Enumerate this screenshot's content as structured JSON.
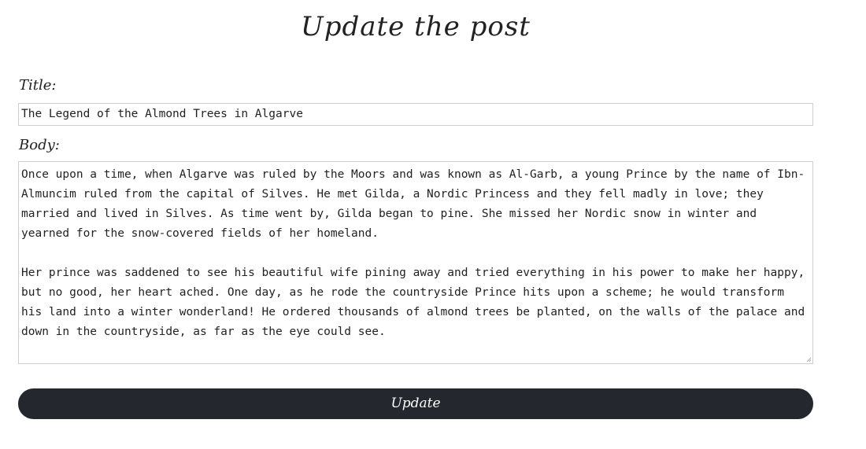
{
  "page_title": "Update the post",
  "title_field": {
    "label": "Title:",
    "value": "The Legend of the Almond Trees in Algarve"
  },
  "body_field": {
    "label": "Body:",
    "paragraphs": [
      "Once upon a time, when Algarve was ruled by the Moors and was known as Al-Garb, a young Prince by the name of Ibn-Almuncim ruled from the capital of Silves. He met Gilda, a Nordic Princess and they fell madly in love; they married and lived in Silves. As time went by, Gilda began to pine. She missed her Nordic snow in winter and yearned for the snow-covered fields of her homeland.",
      "Her prince was saddened to see his beautiful wife pining away and tried everything in his power to make her happy, but no good, her heart ached. One day, as he rode the countryside Prince hits upon a scheme; he would transform his land into a winter wonderland! He ordered thousands of almond trees be planted, on the walls of the palace and down in the countryside, as far as the eye could see."
    ]
  },
  "update_button": {
    "label": "Update",
    "color": "#24272d"
  }
}
